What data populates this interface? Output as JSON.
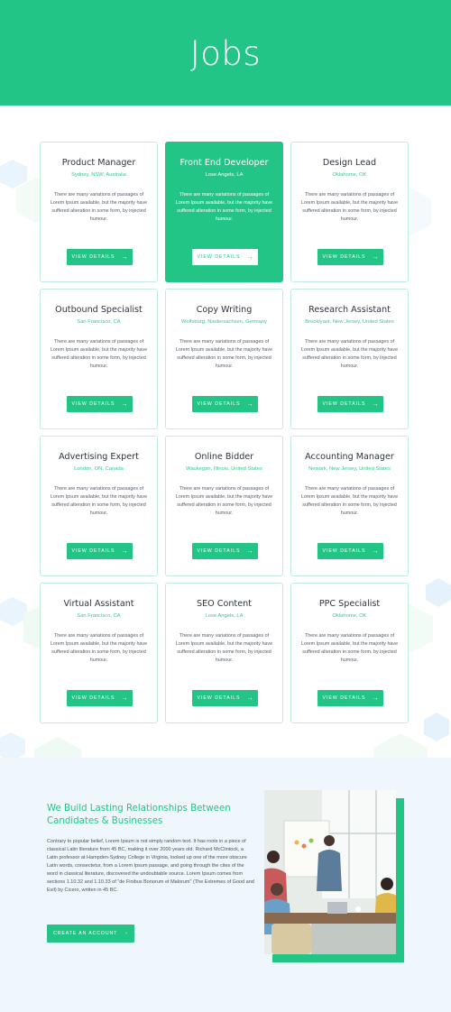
{
  "hero": {
    "title": "Jobs"
  },
  "jobs": [
    {
      "title": "Product Manager",
      "location": "Sydney, NSW, Australia",
      "description": "There are many variations of passages of Lorem Ipsum available, but the majority have suffered alteration in some form, by injected humour.",
      "button": "VIEW DETAILS",
      "featured": false
    },
    {
      "title": "Front End Developer",
      "location": "Lose Angels, LA",
      "description": "There are many variations of passages of Lorem Ipsum available, but the majority have suffered alteration in some form, by injected humour.",
      "button": "VIEW DETAILS",
      "featured": true
    },
    {
      "title": "Design Lead",
      "location": "Oklahome, OK",
      "description": "There are many variations of passages of Lorem Ipsum available, but the majority have suffered alteration in some form, by injected humour.",
      "button": "VIEW DETAILS",
      "featured": false
    },
    {
      "title": "Outbound Specialist",
      "location": "San Francisco, CA",
      "description": "There are many variations of passages of Lorem Ipsum available, but the majority have suffered alteration in some form, by injected humour.",
      "button": "VIEW DETAILS",
      "featured": false
    },
    {
      "title": "Copy Writing",
      "location": "Wolfsburg, Niedersachsen, Germany",
      "description": "There are many variations of passages of Lorem Ipsum available, but the majority have suffered alteration in some form, by injected humour.",
      "button": "VIEW DETAILS",
      "featured": false
    },
    {
      "title": "Research Assistant",
      "location": "Brooklyant, New Jersey, United States",
      "description": "There are many variations of passages of Lorem Ipsum available, but the majority have suffered alteration in some form, by injected humour.",
      "button": "VIEW DETAILS",
      "featured": false
    },
    {
      "title": "Advertising Expert",
      "location": "London, ON, Canada",
      "description": "There are many variations of passages of Lorem Ipsum available, but the majority have suffered alteration in some form, by injected humour.",
      "button": "VIEW DETAILS",
      "featured": false
    },
    {
      "title": "Online Bidder",
      "location": "Waukegan, Illinois, United States",
      "description": "There are many variations of passages of Lorem Ipsum available, but the majority have suffered alteration in some form, by injected humour.",
      "button": "VIEW DETAILS",
      "featured": false
    },
    {
      "title": "Accounting Manager",
      "location": "Newark, New Jersey, United States",
      "description": "There are many variations of passages of Lorem Ipsum available, but the majority have suffered alteration in some form, by injected humour.",
      "button": "VIEW DETAILS",
      "featured": false
    },
    {
      "title": "Virtual Assistant",
      "location": "San Francisco, CA",
      "description": "There are many variations of passages of Lorem Ipsum available, but the majority have suffered alteration in some form, by injected humour.",
      "button": "VIEW DETAILS",
      "featured": false
    },
    {
      "title": "SEO Content",
      "location": "Lose Angels, LA",
      "description": "There are many variations of passages of Lorem Ipsum available, but the majority have suffered alteration in some form, by injected humour.",
      "button": "VIEW DETAILS",
      "featured": false
    },
    {
      "title": "PPC Specialist",
      "location": "Oklahome, OK",
      "description": "There are many variations of passages of Lorem Ipsum available, but the majority have suffered alteration in some form, by injected humour.",
      "button": "VIEW DETAILS",
      "featured": false
    }
  ],
  "about": {
    "heading": "We Build Lasting Relationships Between Candidates & Businesses",
    "body": "Contrary to popular belief, Lorem Ipsum is not simply random text. It has roots in a piece of classical Latin literature from 45 BC, making it over 2000 years old. Richard McClintock, a Latin professor at Hampden-Sydney College in Virginia, looked up one of the more obscure Latin words, consectetur, from a Lorem Ipsum passage, and going through the cites of the word in classical literature, discovered the undoubtable source. Lorem Ipsum comes from sections 1.10.32 and 1.10.33 of \"de Finibus Bonorum et Malorum\" (The Extremes of Good and Evil) by Cicero, written in 45 BC.",
    "cta_label": "CREATE AN ACCOUNT",
    "cta_arrow": "›"
  },
  "icons": {
    "button_arrow": "→",
    "cta_arrow": "chevron-right-icon",
    "photo": "team-meeting-photo"
  },
  "colors": {
    "brand": "#22c585",
    "card_border": "#bfeeda",
    "about_bg": "#eff7fd",
    "title_text": "#2e3440"
  }
}
